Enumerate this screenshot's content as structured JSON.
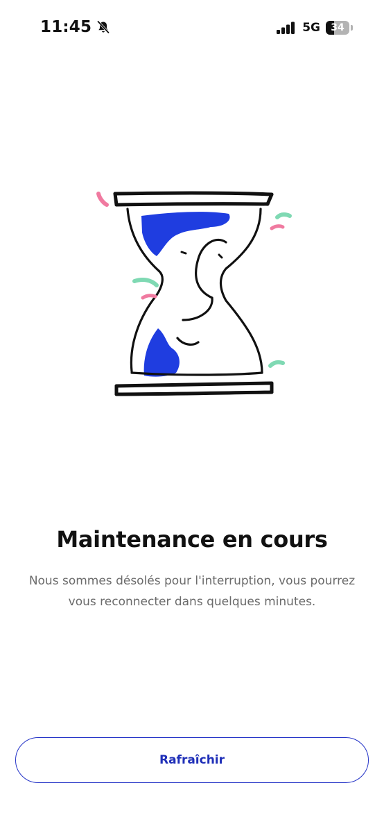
{
  "status_bar": {
    "time": "11:45",
    "network": "5G",
    "battery_level": "34",
    "battery_fraction": 0.34,
    "icons": [
      "bell-slash-icon",
      "signal-bars-icon",
      "battery-icon"
    ]
  },
  "illustration": {
    "icon": "hourglass-illustration",
    "colors": {
      "outline": "#111111",
      "sand": "#1f3de0",
      "accent_green": "#7fd9b3",
      "accent_pink": "#f07aa0"
    }
  },
  "content": {
    "title": "Maintenance en cours",
    "message": "Nous sommes désolés pour l'interruption, vous pourrez vous reconnecter dans quelques minutes."
  },
  "actions": {
    "refresh_label": "Rafraîchir"
  },
  "colors": {
    "accent": "#1f2fb8",
    "text_primary": "#111111",
    "text_secondary": "#6b6b6b",
    "background": "#ffffff"
  }
}
